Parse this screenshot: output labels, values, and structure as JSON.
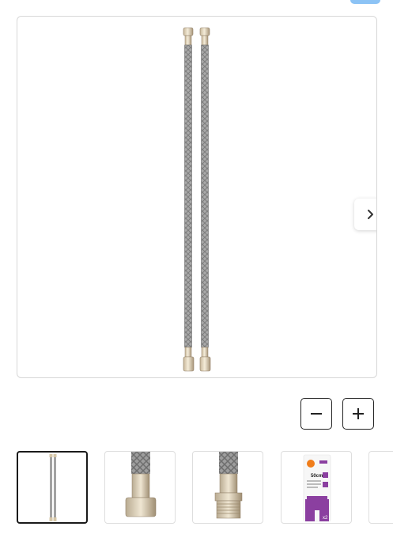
{
  "gallery": {
    "main_image": "braided-hose-pair-image",
    "next_icon": "chevron-right-icon",
    "active_index": 0,
    "thumbnails": [
      {
        "image": "hose-pair-thumbnail"
      },
      {
        "image": "nut-fitting-thumbnail"
      },
      {
        "image": "male-thread-fitting-thumbnail"
      },
      {
        "image": "package-thumbnail",
        "package_length_label": "50cm",
        "package_count_label": "x2"
      },
      {
        "image": "partial-thumbnail"
      }
    ]
  },
  "zoom": {
    "out_icon": "minus-icon",
    "in_icon": "plus-icon"
  },
  "colors": {
    "accent_badge": "#8cc3f5",
    "border": "#d7d7d7",
    "package_purple": "#8b3fa0",
    "package_orange": "#f07d1a"
  }
}
